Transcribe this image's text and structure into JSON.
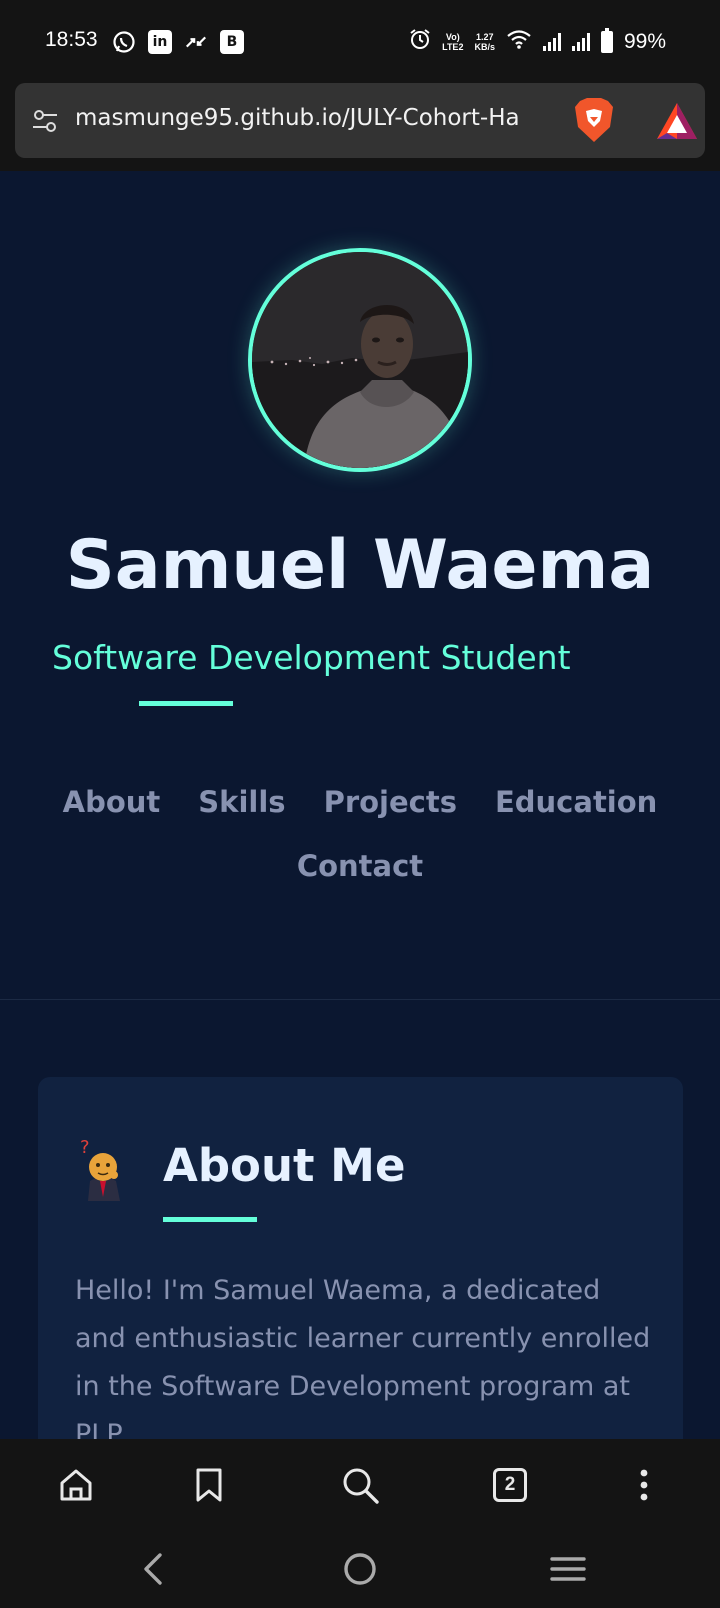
{
  "status_bar": {
    "time": "18:53",
    "apps": [
      "whatsapp-icon",
      "linkedin-icon",
      "data-transfer-icon",
      "bold-b-icon"
    ],
    "linkedin_glyph": "in",
    "b_glyph": "B",
    "volte_top": "Vo)",
    "volte_bottom": "LTE2",
    "speed_value": "1.27",
    "speed_unit": "KB/s",
    "battery": "99%"
  },
  "browser": {
    "url": "masmunge95.github.io/JULY-Cohort-Ha",
    "tab_count": "2"
  },
  "hero": {
    "name": "Samuel Waema",
    "subtitle": "Software Development Student"
  },
  "nav": {
    "row1": [
      "About",
      "Skills",
      "Projects",
      "Education"
    ],
    "row2": [
      "Contact"
    ]
  },
  "about": {
    "title": "About Me",
    "text": "Hello! I'm Samuel Waema, a dedicated and enthusiastic learner currently enrolled in the Software Development program at PLP"
  },
  "colors": {
    "accent": "#64ffda",
    "page_bg": "#0b1730",
    "card_bg": "#112240",
    "heading": "#e6f1ff",
    "muted": "#8892b0"
  }
}
